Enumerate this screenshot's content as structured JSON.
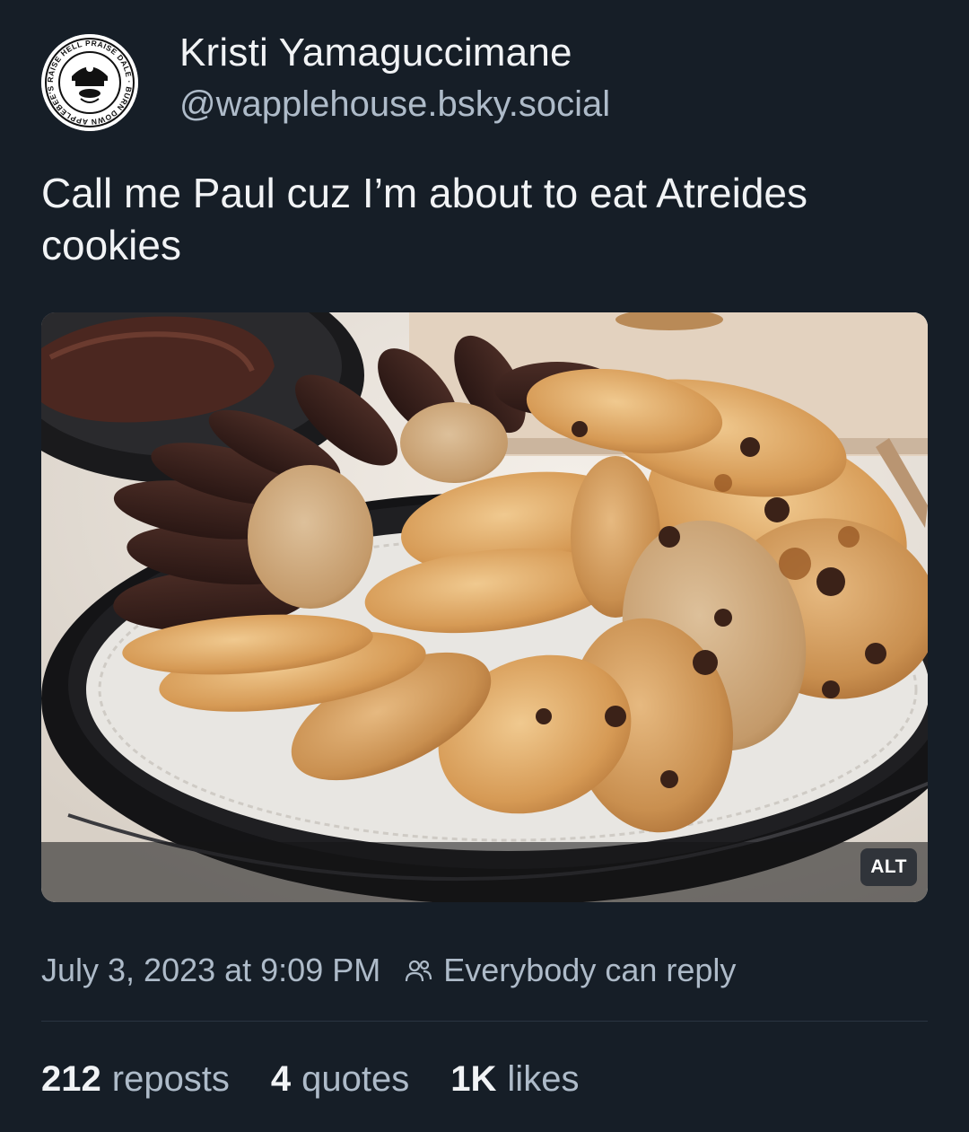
{
  "author": {
    "display_name": "Kristi Yamaguccimane",
    "handle": "@wapplehouse.bsky.social",
    "avatar_ring_text": "RAISE HELL PRAISE DALE · BURN DOWN APPLEBEE'S"
  },
  "post": {
    "text": "Call me Paul cuz I’m about to eat Atreides cookies",
    "image_alt_badge": "ALT",
    "timestamp": "July 3, 2023 at 9:09 PM",
    "reply_setting": "Everybody can reply"
  },
  "stats": {
    "reposts_count": "212",
    "reposts_label": "reposts",
    "quotes_count": "4",
    "quotes_label": "quotes",
    "likes_count": "1K",
    "likes_label": "likes"
  },
  "icons": {
    "reply_setting_icon": "people-icon"
  },
  "colors": {
    "background": "#161e27",
    "text_primary": "#f1f3f5",
    "text_secondary": "#aebbc9",
    "divider": "#2a3441"
  }
}
